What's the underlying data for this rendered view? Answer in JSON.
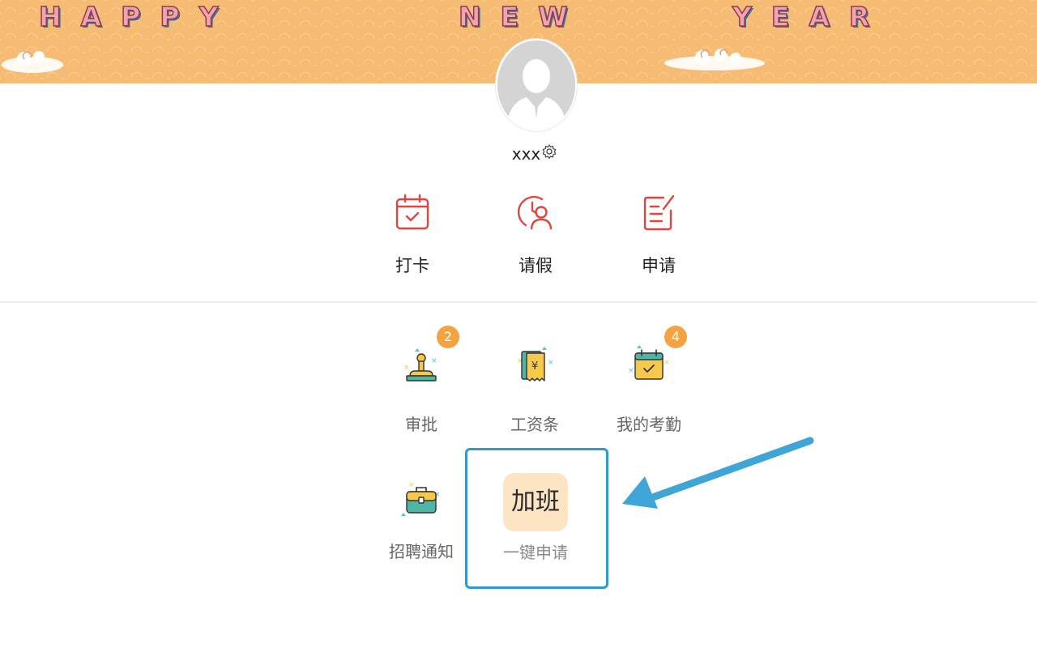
{
  "banner": {
    "words": [
      "HAPPY",
      "NEW",
      "YEAR"
    ]
  },
  "profile": {
    "name": "xxx"
  },
  "quick_actions": [
    {
      "label": "打卡",
      "icon": "calendar-check-icon"
    },
    {
      "label": "请假",
      "icon": "person-clock-icon"
    },
    {
      "label": "申请",
      "icon": "document-edit-icon"
    }
  ],
  "grid": [
    {
      "label": "审批",
      "icon": "stamp-icon",
      "badge": "2"
    },
    {
      "label": "工资条",
      "icon": "payslip-icon",
      "badge": ""
    },
    {
      "label": "我的考勤",
      "icon": "calendar-check-color-icon",
      "badge": "4"
    },
    {
      "label": "招聘通知",
      "icon": "briefcase-icon",
      "badge": ""
    }
  ],
  "overtime": {
    "title": "加班",
    "subtitle": "一键申请"
  },
  "colors": {
    "accent_red": "#e0463f",
    "badge_orange": "#f4a340",
    "highlight_blue": "#2e9ad1",
    "banner": "#f7bc73"
  }
}
